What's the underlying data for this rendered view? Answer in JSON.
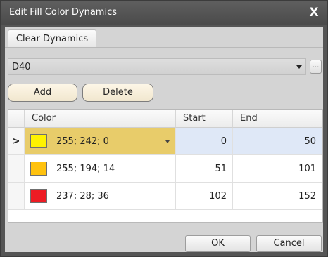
{
  "window": {
    "title": "Edit Fill Color Dynamics",
    "close_glyph": "X"
  },
  "toolbar": {
    "clear_dynamics_label": "Clear Dynamics"
  },
  "dynamics": {
    "selected": "D40",
    "ellipsis_label": "...",
    "add_label": "Add",
    "delete_label": "Delete"
  },
  "grid": {
    "headers": {
      "color": "Color",
      "start": "Start",
      "end": "End"
    },
    "current_row_marker": ">",
    "rows": [
      {
        "color_text": "255; 242; 0",
        "swatch": "#fff200",
        "start": "0",
        "end": "50",
        "selected": true
      },
      {
        "color_text": "255; 194; 14",
        "swatch": "#ffc20e",
        "start": "51",
        "end": "101",
        "selected": false
      },
      {
        "color_text": "237; 28; 36",
        "swatch": "#ed1c24",
        "start": "102",
        "end": "152",
        "selected": false
      }
    ]
  },
  "footer": {
    "ok_label": "OK",
    "cancel_label": "Cancel"
  },
  "colors": {
    "selected_color_cell": "#e8cc6a",
    "selected_row_cells": "#dfe8f7"
  }
}
